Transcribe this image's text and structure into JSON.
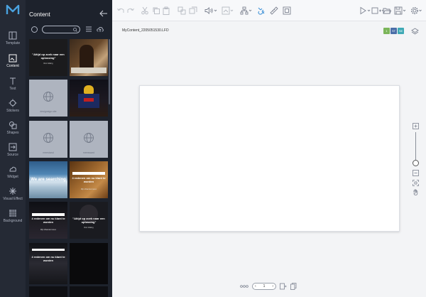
{
  "rail": {
    "items": [
      {
        "label": "Template"
      },
      {
        "label": "Content"
      },
      {
        "label": "Text"
      },
      {
        "label": "Stickers"
      },
      {
        "label": "Shapes"
      },
      {
        "label": "Source"
      },
      {
        "label": "Widget"
      },
      {
        "label": "Visual Effect"
      },
      {
        "label": "Background"
      }
    ],
    "active": "Content"
  },
  "panel": {
    "title": "Content",
    "thumbs": [
      {
        "caption": "\"Altijd op zoek naar een oplossing\"",
        "small": "Ron Gilsing"
      },
      {
        "caption": "",
        "small": ""
      },
      {
        "web_text": "designsign.site"
      },
      {
        "caption": "",
        "small": ""
      },
      {
        "web_text": "meestand"
      },
      {
        "web_text": "meesward"
      },
      {
        "caption": "We are searching",
        "small": ""
      },
      {
        "caption": "4 redenen om nu klant te worden",
        "small": "Mijn Waardenmeten"
      },
      {
        "caption": "4 redenen om nu klant te worden",
        "small": "Mijn Waardenmeten"
      },
      {
        "caption": "\"Altijd op zoek naar een oplossing\"",
        "small": "Ron Gilsing"
      },
      {
        "caption": "4 redenen om nu klant te worden",
        "small": ""
      },
      {
        "caption": "",
        "small": ""
      }
    ]
  },
  "main": {
    "filename": "MyContent_2205051530.LFD",
    "badges": [
      {
        "text": "1",
        "color": "#7bb55a"
      },
      {
        "text": "ST",
        "color": "#4a6ea8"
      },
      {
        "text": "SE",
        "color": "#3fa9b5"
      }
    ],
    "page_number": "1"
  }
}
